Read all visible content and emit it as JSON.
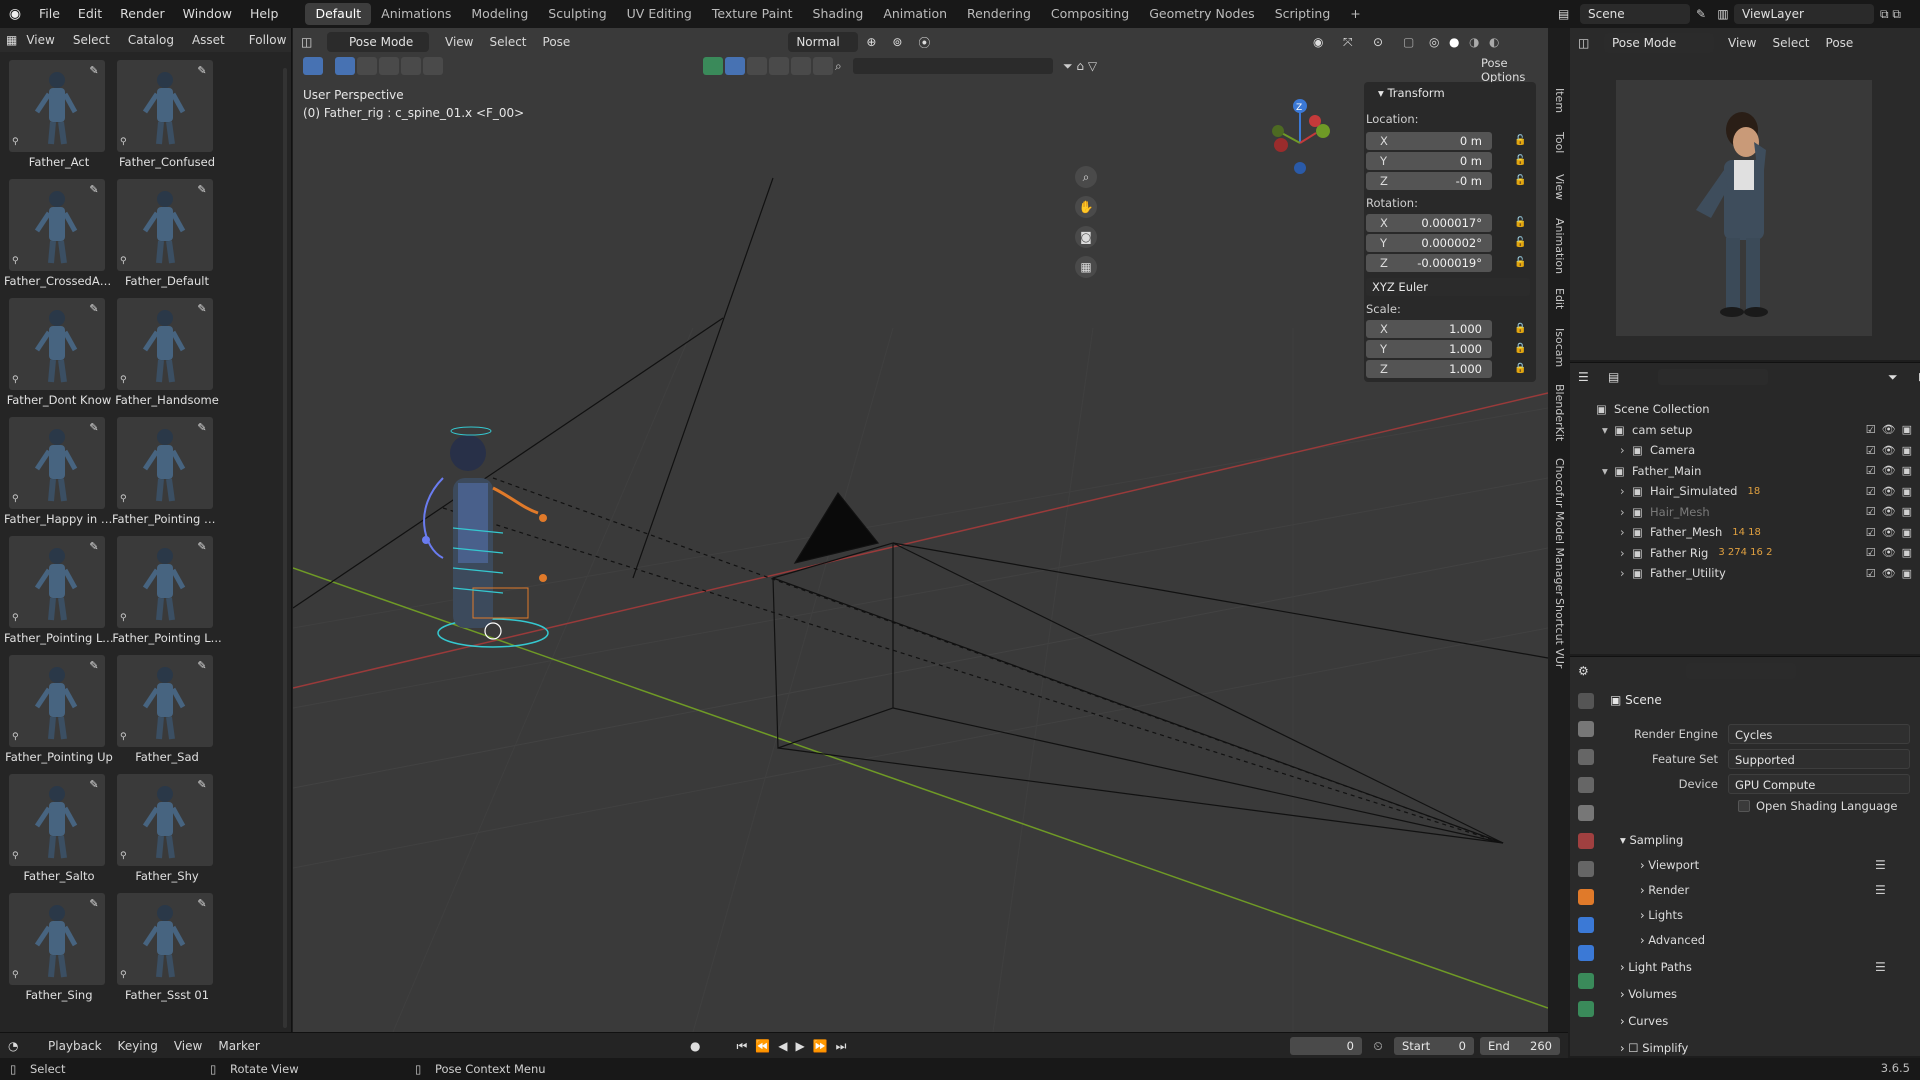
{
  "topbar": {
    "menus": [
      "File",
      "Edit",
      "Render",
      "Window",
      "Help"
    ],
    "workspaces": [
      "Default",
      "Animations",
      "Modeling",
      "Sculpting",
      "UV Editing",
      "Texture Paint",
      "Shading",
      "Animation",
      "Rendering",
      "Compositing",
      "Geometry Nodes",
      "Scripting"
    ],
    "active_workspace": "Default",
    "scene": "Scene",
    "view_layer": "ViewLayer"
  },
  "asset_browser": {
    "header": [
      "View",
      "Select",
      "Catalog",
      "Asset"
    ],
    "follow": "Follow",
    "assets": [
      "Father_Act",
      "Father_Confused",
      "Father_CrossedArm",
      "Father_Default",
      "Father_Dont Know",
      "Father_Handsome",
      "Father_Happy in Air",
      "Father_Pointing D...",
      "Father_Pointing Left",
      "Father_Pointing L...",
      "Father_Pointing Up",
      "Father_Sad",
      "Father_Salto",
      "Father_Shy",
      "Father_Sing",
      "Father_Ssst 01"
    ]
  },
  "viewport": {
    "mode": "Pose Mode",
    "menus": [
      "View",
      "Select",
      "Pose"
    ],
    "orientation": "Normal",
    "perspective_label": "User Perspective",
    "object_label": "(0) Father_rig : c_spine_01.x <F_00>",
    "pose_options": "Pose Options"
  },
  "transform": {
    "title": "Transform",
    "location_label": "Location:",
    "location": [
      "0 m",
      "0 m",
      "-0 m"
    ],
    "rotation_label": "Rotation:",
    "rotation": [
      "0.000017°",
      "0.000002°",
      "-0.000019°"
    ],
    "rotation_mode": "XYZ Euler",
    "scale_label": "Scale:",
    "scale": [
      "1.000",
      "1.000",
      "1.000"
    ],
    "axes": [
      "X",
      "Y",
      "Z"
    ]
  },
  "side_tabs": [
    "Item",
    "Tool",
    "View",
    "Animation",
    "Edit",
    "Isocam",
    "BlenderKit",
    "Chocofur Model Manager",
    "Shortcut VUr"
  ],
  "right_header": {
    "mode": "Pose Mode",
    "menus": [
      "View",
      "Select",
      "Pose"
    ]
  },
  "outliner": {
    "rows": [
      {
        "label": "Scene Collection",
        "indent": 0
      },
      {
        "label": "cam setup",
        "indent": 1
      },
      {
        "label": "Camera",
        "indent": 2
      },
      {
        "label": "Father_Main",
        "indent": 1
      },
      {
        "label": "Hair_Simulated",
        "indent": 2,
        "badge": "18"
      },
      {
        "label": "Hair_Mesh",
        "indent": 2,
        "dim": true
      },
      {
        "label": "Father_Mesh",
        "indent": 2,
        "badge": "14 18"
      },
      {
        "label": "Father Rig",
        "indent": 2,
        "badge": "3 274 16 2"
      },
      {
        "label": "Father_Utility",
        "indent": 2
      }
    ]
  },
  "properties": {
    "context": "Scene",
    "render_engine_label": "Render Engine",
    "render_engine": "Cycles",
    "feature_set_label": "Feature Set",
    "feature_set": "Supported",
    "device_label": "Device",
    "device": "GPU Compute",
    "osl_label": "Open Shading Language",
    "panels": [
      "Sampling",
      "Viewport",
      "Render",
      "Lights",
      "Advanced",
      "Light Paths",
      "Volumes",
      "Curves",
      "Simplify"
    ]
  },
  "timeline": {
    "menus": [
      "Playback",
      "Keying",
      "View",
      "Marker"
    ],
    "current_frame": "0",
    "start_label": "Start",
    "start": "0",
    "end_label": "End",
    "end": "260"
  },
  "statusbar": {
    "hints": [
      "Select",
      "Rotate View",
      "Pose Context Menu"
    ],
    "version": "3.6.5"
  },
  "colors": {
    "accent": "#4772b3",
    "x_axis": "#c43a3a",
    "y_axis": "#6f9a26",
    "z_axis": "#3b79d6"
  }
}
